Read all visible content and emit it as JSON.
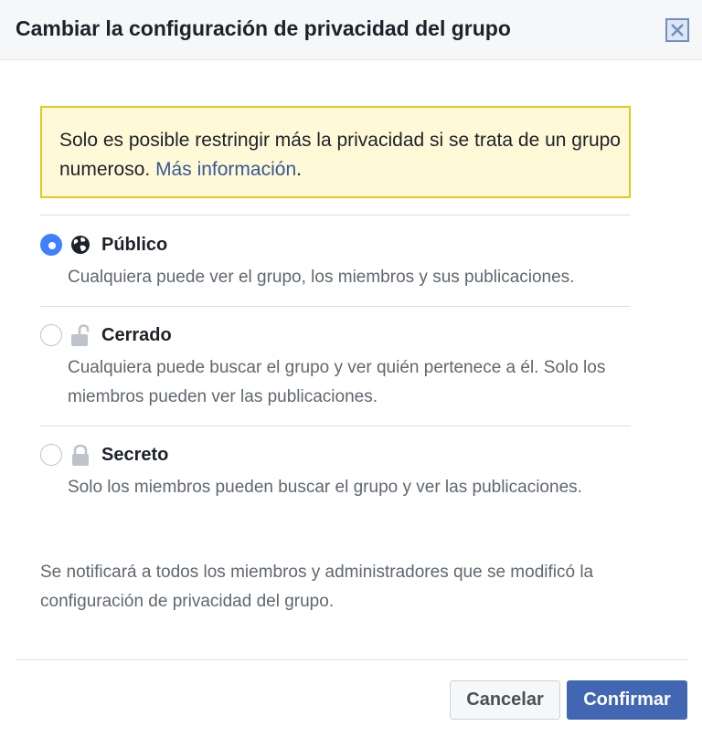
{
  "dialog": {
    "title": "Cambiar la configuración de privacidad del grupo",
    "close_icon": "close-icon"
  },
  "notice": {
    "text": "Solo es posible restringir más la privacidad si se trata de un grupo numeroso. ",
    "link": "Más información",
    "suffix": "."
  },
  "options": [
    {
      "label": "Público",
      "icon": "globe-icon",
      "selected": true,
      "description": "Cualquiera puede ver el grupo, los miembros y sus publicaciones."
    },
    {
      "label": "Cerrado",
      "icon": "unlocked-padlock-icon",
      "selected": false,
      "description": "Cualquiera puede buscar el grupo y ver quién pertenece a él. Solo los miembros pueden ver las publicaciones."
    },
    {
      "label": "Secreto",
      "icon": "locked-padlock-icon",
      "selected": false,
      "description": "Solo los miembros pueden buscar el grupo y ver las publicaciones."
    }
  ],
  "footnote": "Se notificará a todos los miembros y administradores que se modificó la configuración de privacidad del grupo.",
  "buttons": {
    "cancel": "Cancelar",
    "confirm": "Confirmar"
  },
  "colors": {
    "accent": "#4080ff",
    "confirm_button": "#4267b2",
    "link": "#365899",
    "notice_background": "#fff9d7",
    "notice_border": "#e2c822"
  }
}
